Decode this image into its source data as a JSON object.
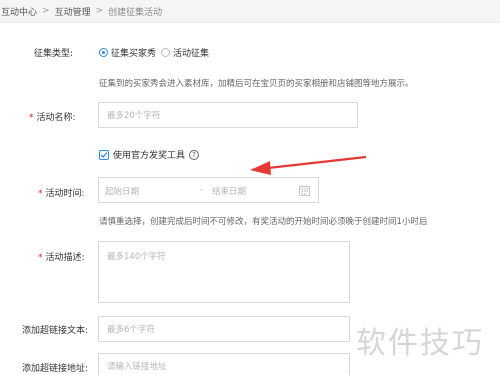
{
  "breadcrumb": {
    "items": [
      "互动中心",
      "互动管理",
      "创建征集活动"
    ]
  },
  "form": {
    "collect_type": {
      "label": "征集类型:",
      "options": [
        "征集买家秀",
        "活动征集"
      ],
      "selected": "征集买家秀"
    },
    "collect_hint": "征集到的买家秀会进入素材库，加精后可在宝贝页的买家相册和店铺图等地方展示。",
    "activity_name": {
      "label": "活动名称:",
      "placeholder": "最多20个字符"
    },
    "official_tool": {
      "label": "使用官方发奖工具",
      "checked": true,
      "help": "?"
    },
    "activity_time": {
      "label": "活动时间:",
      "start_placeholder": "起始日期",
      "separator": "-",
      "end_placeholder": "结束日期"
    },
    "time_hint": "请慎重选择，创建完成后时间不可修改，有奖活动的开始时间必须晚于创建时间1小时后",
    "activity_desc": {
      "label": "活动描述:",
      "placeholder": "最多140个字符"
    },
    "link_text": {
      "label": "添加超链接文本:",
      "placeholder": "最多6个字符"
    },
    "link_url": {
      "label": "添加超链接地址:",
      "placeholder": "请输入链接地址"
    }
  },
  "watermark": "软件技巧",
  "colors": {
    "accent": "#3089dc",
    "required": "#e02020",
    "arrow": "#e53935"
  }
}
